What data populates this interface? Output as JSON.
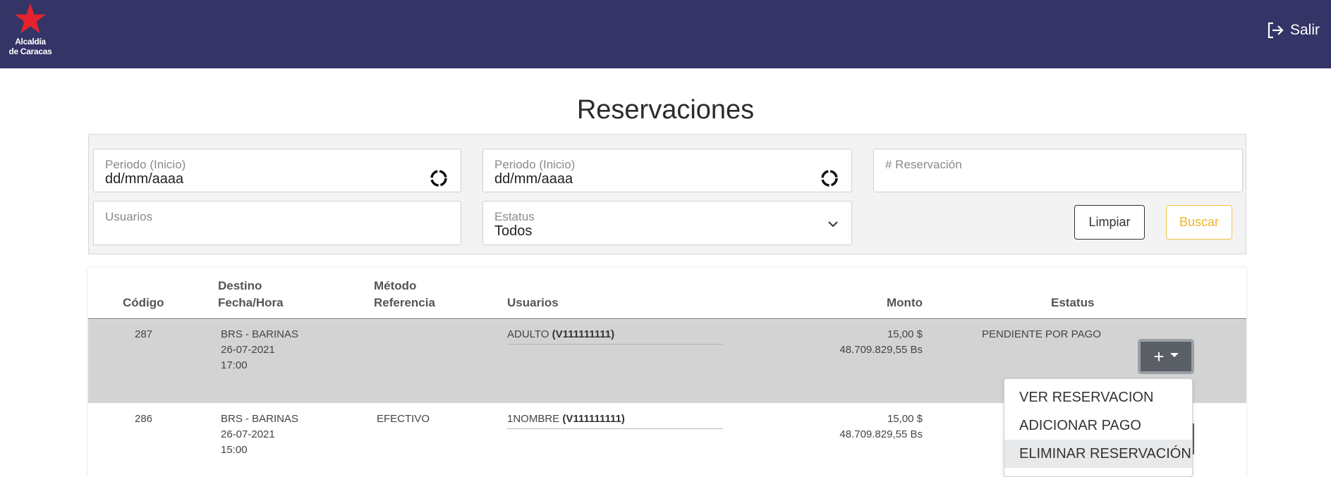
{
  "header": {
    "logo_line1": "Alcaldía",
    "logo_line2": "de Caracas",
    "logout_label": "Salir"
  },
  "page": {
    "title": "Reservaciones"
  },
  "filters": {
    "start_label": "Periodo (Inicio)",
    "start_value": "dd/mm/aaaa",
    "end_label": "Periodo (Inicio)",
    "end_value": "dd/mm/aaaa",
    "reservation_placeholder": "# Reservación",
    "users_placeholder": "Usuarios",
    "status_label": "Estatus",
    "status_value": "Todos",
    "clear_label": "Limpiar",
    "search_label": "Buscar"
  },
  "table": {
    "headers": {
      "code": "Código",
      "destination": "Destino",
      "datetime": "Fecha/Hora",
      "method": "Método",
      "reference": "Referencia",
      "users": "Usuarios",
      "amount": "Monto",
      "status": "Estatus"
    },
    "rows": [
      {
        "code": "287",
        "destination": "BRS - BARINAS",
        "date": "26-07-2021",
        "time": "17:00",
        "method": "",
        "user_type": "ADULTO",
        "user_id": "(V111111111)",
        "amount_usd": "15,00 $",
        "amount_bs": "48.709.829,55 Bs",
        "status": "PENDIENTE POR PAGO"
      },
      {
        "code": "286",
        "destination": "BRS - BARINAS",
        "date": "26-07-2021",
        "time": "15:00",
        "method": "EFECTIVO",
        "user_type": "1NOMBRE",
        "user_id": "(V111111111)",
        "amount_usd": "15,00 $",
        "amount_bs": "48.709.829,55 Bs",
        "status": ""
      }
    ]
  },
  "actions": {
    "plus_symbol": "+",
    "menu": [
      "VER RESERVACION",
      "ADICIONAR PAGO",
      "ELIMINAR RESERVACIÓN"
    ]
  },
  "colors": {
    "header_bg": "#353466",
    "logo_star": "#e5232d",
    "search_accent": "#f0b52a"
  }
}
